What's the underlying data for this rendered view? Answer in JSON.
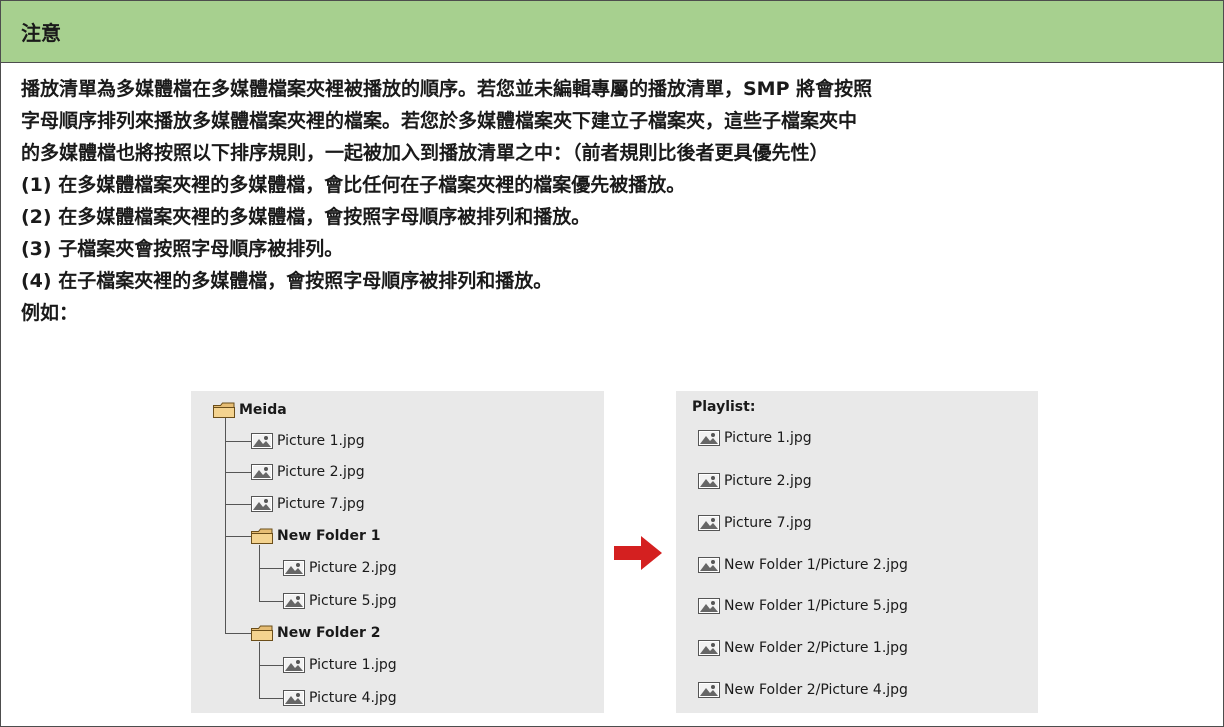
{
  "note": {
    "title": "注意",
    "lines": [
      "播放清單為多媒體檔在多媒體檔案夾裡被播放的順序。若您並未編輯專屬的播放清單，SMP 將會按照",
      "字母順序排列來播放多媒體檔案夾裡的檔案。若您於多媒體檔案夾下建立子檔案夾，這些子檔案夾中",
      "的多媒體檔也將按照以下排序規則，一起被加入到播放清單之中：（前者規則比後者更具優先性）",
      "(1) 在多媒體檔案夾裡的多媒體檔，會比任何在子檔案夾裡的檔案優先被播放。",
      "(2) 在多媒體檔案夾裡的多媒體檔，會按照字母順序被排列和播放。",
      "(3) 子檔案夾會按照字母順序被排列。",
      "(4) 在子檔案夾裡的多媒體檔，會按照字母順序被排列和播放。",
      "例如："
    ]
  },
  "tree": {
    "root": "Meida",
    "items": [
      "Picture 1.jpg",
      "Picture 2.jpg",
      "Picture 7.jpg",
      "New Folder 1",
      "Picture 2.jpg",
      "Picture 5.jpg",
      "New Folder 2",
      "Picture 1.jpg",
      "Picture 4.jpg"
    ]
  },
  "playlist": {
    "title": "Playlist:",
    "items": [
      "Picture 1.jpg",
      "Picture 2.jpg",
      "Picture 7.jpg",
      "New Folder 1/Picture 2.jpg",
      "New Folder 1/Picture 5.jpg",
      "New Folder 2/Picture 1.jpg",
      "New Folder 2/Picture 4.jpg"
    ]
  },
  "icons": {
    "folder": "folder-icon",
    "image_file": "image-file-icon",
    "arrow": "right-arrow-icon"
  },
  "colors": {
    "header_bg": "#a7d08f",
    "panel_bg": "#e9e9e9",
    "arrow": "#d42020",
    "folder": "#e0b060"
  }
}
